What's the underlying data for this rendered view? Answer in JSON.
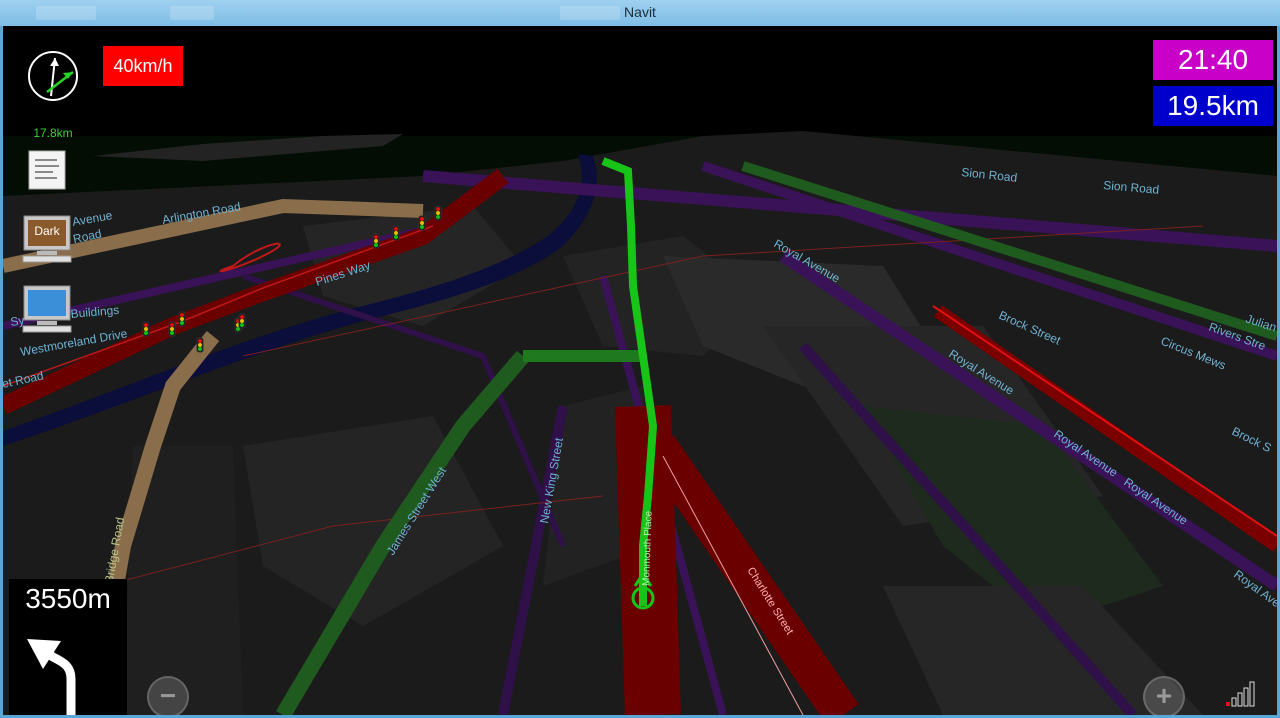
{
  "window": {
    "title": "Navit"
  },
  "osd": {
    "compass_distance": "17.8km",
    "speed_limit": "40km/h",
    "arrival_time": "21:40",
    "distance_remaining": "19.5km",
    "next_maneuver_distance": "3550m",
    "zoom_in_label": "+",
    "zoom_out_label": "−",
    "theme_button_label": "Dark",
    "colors": {
      "speed_bg": "#ff0000",
      "time_bg": "#c800c8",
      "eta_bg": "#0000cc",
      "route_green": "#18c418"
    }
  },
  "map": {
    "labels": {
      "sion_road_1": "Sion Road",
      "sion_road_2": "Sion Road",
      "arlington_road": "Arlington Road",
      "avenue_left": "Avenue",
      "ry_road": "ry Road",
      "pines_way": "Pines Way",
      "royal_avenue_1": "Royal Avenue",
      "royal_avenue_2": "Royal Avenue",
      "royal_avenue_3": "Royal Avenue",
      "royal_avenue_4": "Royal Avenue",
      "royal_avenue_5": "Royal Ave",
      "brock_street_1": "Brock Street",
      "brock_street_2": "Brock S",
      "circus_mews": "Circus Mews",
      "rivers_street": "Rivers Stre",
      "julian": "Julian",
      "buildings": "Buildings",
      "westmoreland_drive": "Westmoreland Drive",
      "et_road": "et Road",
      "sy": "Sy",
      "new_king_street": "New King Street",
      "james_street_west": "James Street West",
      "charlotte_street": "Charlotte Street",
      "monmouth_place": "Monmouth Place",
      "midland_bridge_road": "dland Bridge Road"
    }
  }
}
